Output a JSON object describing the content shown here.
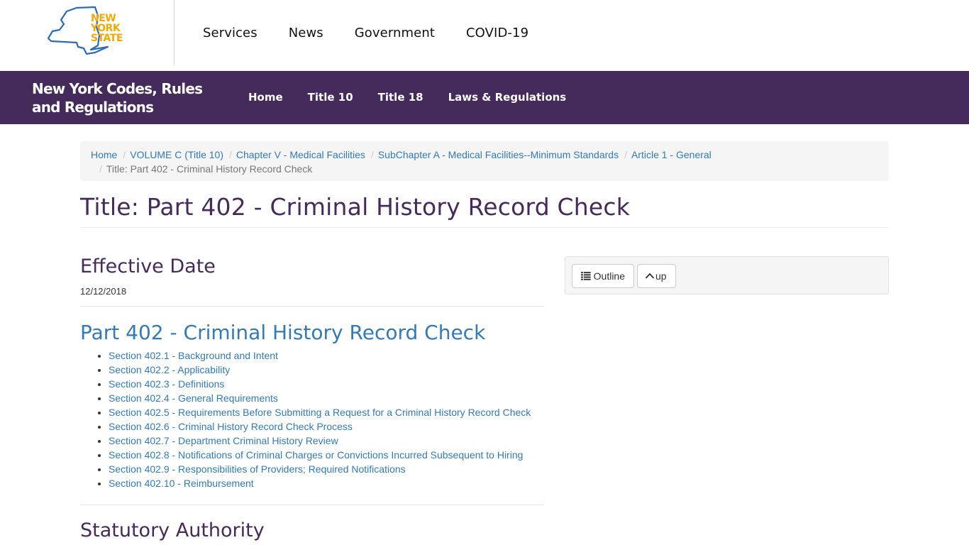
{
  "header": {
    "logo": {
      "lines": [
        "NEW",
        "YORK",
        "STATE"
      ],
      "icon": "ny-state-map-icon",
      "color_text": "#f2a900",
      "color_outline": "#2b6bb8"
    },
    "top_nav": [
      {
        "label": "Services"
      },
      {
        "label": "News"
      },
      {
        "label": "Government"
      },
      {
        "label": "COVID-19"
      }
    ]
  },
  "site_bar": {
    "title_line1": "New York Codes, Rules",
    "title_line2": "and Regulations",
    "nav": [
      {
        "label": "Home"
      },
      {
        "label": "Title 10"
      },
      {
        "label": "Title 18"
      },
      {
        "label": "Laws & Regulations"
      }
    ],
    "color": "#452a5c"
  },
  "breadcrumb": {
    "items": [
      {
        "label": "Home"
      },
      {
        "label": "VOLUME C (Title 10)"
      },
      {
        "label": "Chapter V - Medical Facilities"
      },
      {
        "label": "SubChapter A - Medical Facilities--Minimum Standards"
      },
      {
        "label": "Article 1 - General"
      }
    ],
    "active": "Title: Part 402 - Criminal History Record Check",
    "separator": "/"
  },
  "page": {
    "title": "Title: Part 402 - Criminal History Record Check",
    "effective_date_heading": "Effective Date",
    "effective_date": "12/12/2018",
    "part_heading": "Part 402 - Criminal History Record Check",
    "sections": [
      {
        "label": "Section 402.1 - Background and Intent"
      },
      {
        "label": "Section 402.2 - Applicability"
      },
      {
        "label": "Section 402.3 - Definitions"
      },
      {
        "label": "Section 402.4 - General Requirements"
      },
      {
        "label": "Section 402.5 - Requirements Before Submitting a Request for a Criminal History Record Check"
      },
      {
        "label": "Section 402.6 - Criminal History Record Check Process"
      },
      {
        "label": "Section 402.7 - Department Criminal History Review"
      },
      {
        "label": "Section 402.8 - Notifications of Criminal Charges or Convictions Incurred Subsequent to Hiring"
      },
      {
        "label": "Section 402.9 - Responsibilities of Providers; Required Notifications"
      },
      {
        "label": "Section 402.10 - Reimbursement"
      }
    ],
    "statutory_heading": "Statutory Authority"
  },
  "sidebar": {
    "outline_button": {
      "label": "Outline",
      "icon": "list-icon"
    },
    "up_button": {
      "label": "up",
      "icon": "chevron-up-icon"
    }
  }
}
